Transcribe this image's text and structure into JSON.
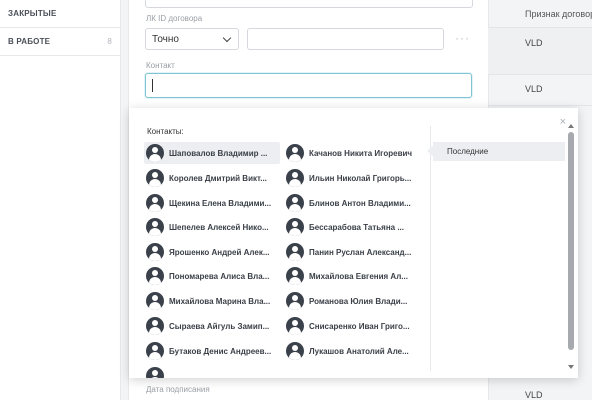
{
  "sidebar": {
    "items": [
      {
        "label": "ЗАКРЫТЫЕ",
        "count": ""
      },
      {
        "label": "В РАБОТЕ",
        "count": "8"
      }
    ]
  },
  "form": {
    "contract_id_label": "ЛК ID договора",
    "match_select_value": "Точно",
    "more_label": "···",
    "contact_label": "Контакт",
    "contact_value": "",
    "sign_date_label": "Дата подписания"
  },
  "table": {
    "header": "Признак договора",
    "rows": [
      "VLD",
      "VLD",
      "VLD"
    ]
  },
  "popup": {
    "close_label": "×",
    "contacts_title": "Контакты:",
    "recent_tab": "Последние",
    "contacts_left": [
      "Шаповалов Владимир ...",
      "Королев Дмитрий Викт...",
      "Щекина Елена Владими...",
      "Шепелев Алексей Нико...",
      "Ярошенко Андрей Алек...",
      "Пономарева Алиса Вла...",
      "Михайлова Марина Вла...",
      "Сыраева Айгуль Замип...",
      "Бутаков Денис Андреев..."
    ],
    "contacts_right": [
      "Качанов Никита Игоревич",
      "Ильин Николай Григорь...",
      "Блинов Антон Владими...",
      "Бессарабова Татьяна ...",
      "Панин Руслан Александ...",
      "Михайлова Евгения Ал...",
      "Романова Юлия Влади...",
      "Снисаренко Иван Григо...",
      "Лукашов Анатолий Але..."
    ]
  },
  "colors": {
    "accent_focus": "#7fc4d3",
    "avatar": "#3a414b",
    "highlight": "#eceef1"
  }
}
